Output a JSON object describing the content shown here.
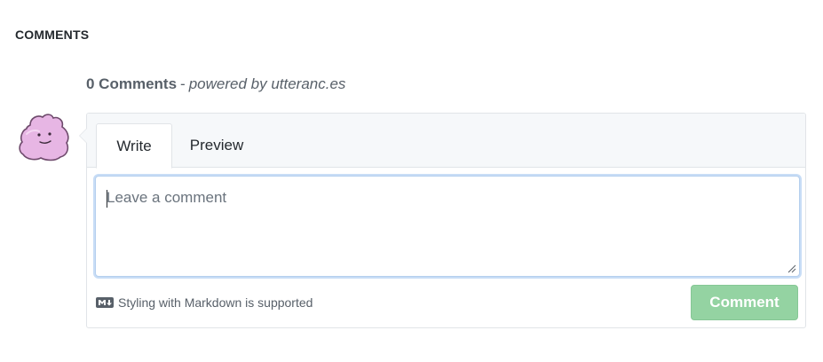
{
  "section": {
    "title": "COMMENTS"
  },
  "header": {
    "count": "0 Comments",
    "separator": "-",
    "powered_by": "powered by utteranc.es"
  },
  "editor": {
    "tabs": [
      {
        "label": "Write",
        "active": true
      },
      {
        "label": "Preview",
        "active": false
      }
    ],
    "placeholder": "Leave a comment",
    "value": "",
    "markdown_note": "Styling with Markdown is supported",
    "submit_label": "Comment",
    "submit_disabled": true
  },
  "icons": {
    "avatar": "ditto-avatar-icon",
    "markdown": "markdown-icon",
    "resize": "resize-grip-icon"
  },
  "colors": {
    "submit_bg": "#94d3a2",
    "focus_border": "#b5cfee",
    "tab_bar_bg": "#f6f8fa",
    "avatar_fill": "#e7b6e4"
  }
}
